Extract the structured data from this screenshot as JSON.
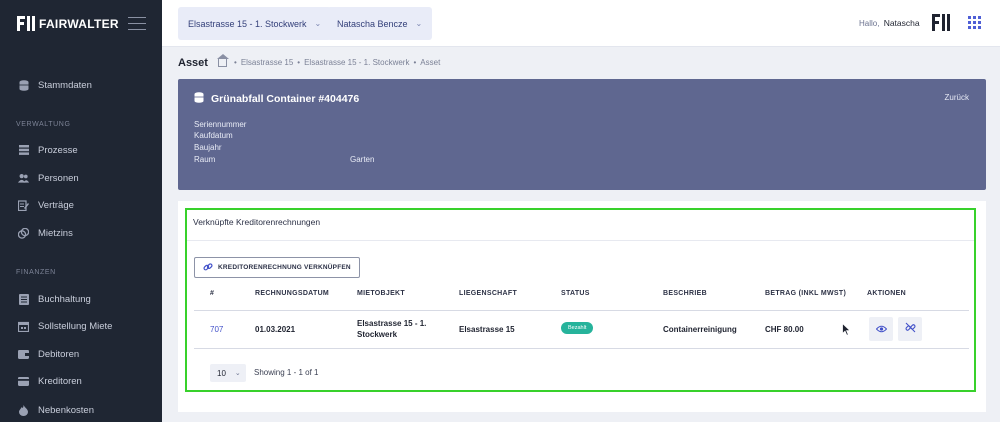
{
  "sidebar": {
    "logo_text": "FAIRWALTER",
    "items": [
      {
        "label": "Stammdaten",
        "icon": "database-icon"
      },
      {
        "label": "Prozesse",
        "icon": "stack-icon"
      },
      {
        "label": "Personen",
        "icon": "users-icon"
      },
      {
        "label": "Verträge",
        "icon": "document-edit-icon"
      },
      {
        "label": "Mietzins",
        "icon": "coins-icon"
      },
      {
        "label": "Buchhaltung",
        "icon": "ledger-icon"
      },
      {
        "label": "Sollstellung Miete",
        "icon": "calendar-icon"
      },
      {
        "label": "Debitoren",
        "icon": "wallet-icon"
      },
      {
        "label": "Kreditoren",
        "icon": "credit-card-icon"
      },
      {
        "label": "Nebenkosten",
        "icon": "flame-icon"
      }
    ],
    "sections": {
      "verwaltung": "VERWALTUNG",
      "finanzen": "FINANZEN"
    }
  },
  "header": {
    "property_selector": "Elsastrasse 15 - 1. Stockwerk",
    "person_selector": "Natascha Bencze",
    "greeting": "Hallo,",
    "user_name": "Natascha"
  },
  "page": {
    "title": "Asset",
    "breadcrumb": [
      "Elsastrasse 15",
      "Elsastrasse 15 - 1. Stockwerk",
      "Asset"
    ]
  },
  "asset": {
    "title": "Grünabfall Container #404476",
    "back_label": "Zurück",
    "attributes": [
      {
        "label": "Seriennummer",
        "value": ""
      },
      {
        "label": "Kaufdatum",
        "value": ""
      },
      {
        "label": "Baujahr",
        "value": ""
      },
      {
        "label": "Raum",
        "value": "Garten"
      }
    ]
  },
  "invoices": {
    "section_title": "Verknüpfte Kreditorenrechnungen",
    "link_button_label": "KREDITORENRECHNUNG VERKNÜPFEN",
    "columns": [
      "#",
      "RECHNUNGSDATUM",
      "MIETOBJEKT",
      "LIEGENSCHAFT",
      "STATUS",
      "BESCHRIEB",
      "BETRAG (INKL MWST)",
      "AKTIONEN"
    ],
    "rows": [
      {
        "id": "707",
        "date": "01.03.2021",
        "object_line1": "Elsastrasse 15 - 1.",
        "object_line2": "Stockwerk",
        "property": "Elsastrasse 15",
        "status": "Bezahlt",
        "description": "Containerreinigung",
        "amount": "CHF 80.00"
      }
    ],
    "page_size": "10",
    "showing": "Showing 1 - 1 of 1"
  },
  "colors": {
    "sidebar_bg": "#1f2633",
    "asset_card_bg": "#5f6790",
    "highlight_outline": "#38d12b",
    "status_paid": "#26b39b",
    "link_accent": "#4251c9"
  }
}
